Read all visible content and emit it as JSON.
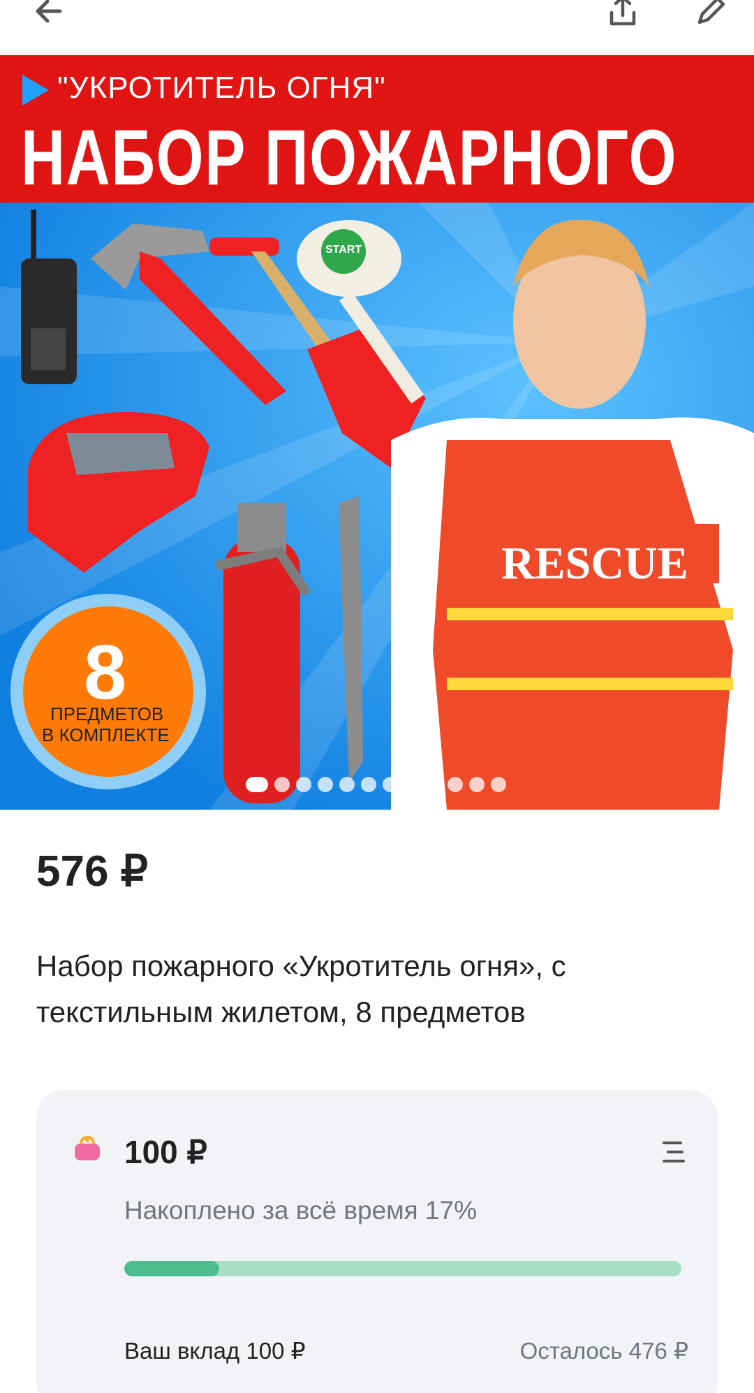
{
  "toolbar": {
    "back_icon": "arrow-left-icon",
    "share_icon": "share-upload-icon",
    "edit_icon": "pencil-icon"
  },
  "gallery": {
    "image_subtitle": "\"УКРОТИТЕЛЬ ОГНЯ\"",
    "image_title": "НАБОР ПОЖАРНОГО",
    "badge_number": "8",
    "badge_line1": "ПРЕДМЕТОВ",
    "badge_line2": "В КОМПЛЕКТЕ",
    "vest_label": "RESCUE",
    "sign_label": "START",
    "dots_count": 12,
    "active_dot": 0
  },
  "product": {
    "price": "576 ₽",
    "title": "Набор пожарного «Укротитель огня», с текстильным жилетом, 8 предметов"
  },
  "savings": {
    "wallet_icon": "wallet-purse-icon",
    "amount": "100 ₽",
    "menu_icon": "list-menu-icon",
    "saved_text": "Накоплено за всё время 17%",
    "progress_fraction": 0.17,
    "contribution": "Ваш вклад 100 ₽",
    "remaining": "Осталось 476 ₽"
  },
  "colors": {
    "accent_green": "#4bbd8f",
    "progress_track": "#a8dec6",
    "banner_red": "#e11414",
    "banner_blue": "#1d8fe8"
  }
}
